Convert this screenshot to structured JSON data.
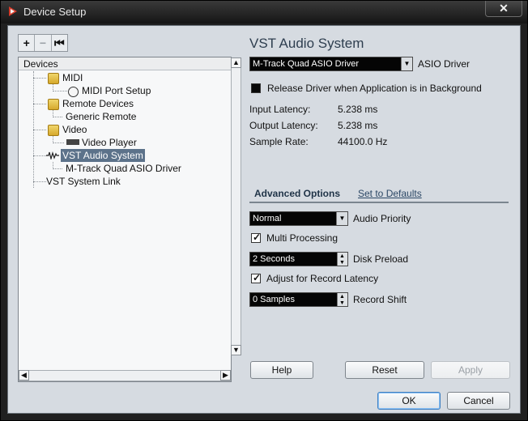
{
  "window": {
    "title": "Device Setup",
    "close_symbol": "✕"
  },
  "toolbar": {
    "add": "+",
    "remove": "−",
    "reset": "⏮"
  },
  "devices": {
    "header": "Devices",
    "items": [
      {
        "label": "MIDI"
      },
      {
        "label": "MIDI Port Setup"
      },
      {
        "label": "Remote Devices"
      },
      {
        "label": "Generic Remote"
      },
      {
        "label": "Video"
      },
      {
        "label": "Video Player"
      },
      {
        "label": "VST Audio System"
      },
      {
        "label": "M-Track Quad ASIO Driver"
      },
      {
        "label": "VST System Link"
      }
    ]
  },
  "vst": {
    "title": "VST Audio System",
    "driver": {
      "value": "M-Track Quad ASIO Driver",
      "label": "ASIO Driver"
    },
    "release_driver": {
      "label": "Release Driver when Application is in Background",
      "checked": false
    },
    "stats": [
      {
        "label": "Input Latency:",
        "value": "5.238 ms"
      },
      {
        "label": "Output Latency:",
        "value": "5.238 ms"
      },
      {
        "label": "Sample Rate:",
        "value": "44100.0 Hz"
      }
    ]
  },
  "advanced": {
    "tab": "Advanced Options",
    "defaults_link": "Set to Defaults",
    "audio_priority": {
      "value": "Normal",
      "label": "Audio Priority"
    },
    "multi_processing": {
      "label": "Multi Processing",
      "checked": true
    },
    "disk_preload": {
      "value": "2 Seconds",
      "label": "Disk Preload"
    },
    "adjust_latency": {
      "label": "Adjust for Record Latency",
      "checked": true
    },
    "record_shift": {
      "value": "0 Samples",
      "label": "Record Shift"
    }
  },
  "buttons": {
    "help": "Help",
    "reset": "Reset",
    "apply": "Apply",
    "ok": "OK",
    "cancel": "Cancel"
  }
}
